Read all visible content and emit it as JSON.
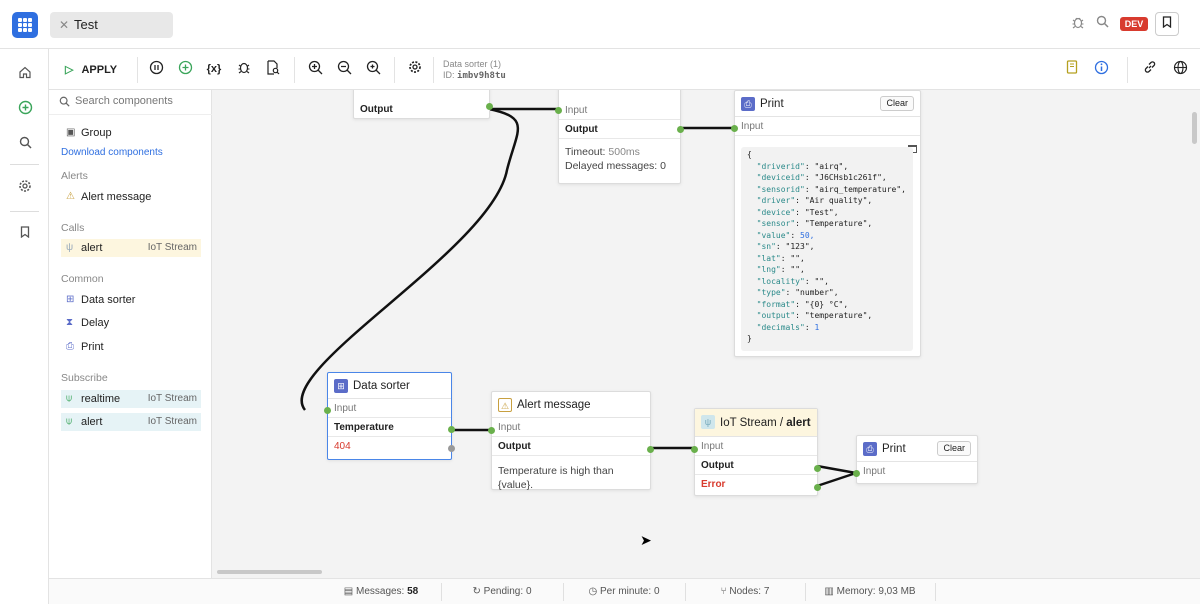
{
  "tab": {
    "title": "Test",
    "close": "✕"
  },
  "top_right": {
    "dev_badge": "DEV"
  },
  "toolbar": {
    "apply_label": "APPLY",
    "info_line1": "Data sorter (1)",
    "info_id_label": "ID:",
    "info_id_value": "imbv9h8tu"
  },
  "sidebar": {
    "search_placeholder": "Search components",
    "group_label": "Group",
    "download_link": "Download components",
    "sections": {
      "alerts": "Alerts",
      "calls": "Calls",
      "common": "Common",
      "subscribe": "Subscribe"
    },
    "items": {
      "alert_message": "Alert message",
      "call_alert": "alert",
      "call_alert_tag": "IoT Stream",
      "data_sorter": "Data sorter",
      "delay": "Delay",
      "print": "Print",
      "sub_realtime": "realtime",
      "sub_realtime_tag": "IoT Stream",
      "sub_alert": "alert",
      "sub_alert_tag": "IoT Stream"
    }
  },
  "nodes": {
    "top_left": {
      "output": "Output"
    },
    "delay": {
      "input": "Input",
      "output": "Output",
      "timeout_label": "Timeout:",
      "timeout_value": "500ms",
      "delayed_label": "Delayed messages:",
      "delayed_value": "0"
    },
    "print_top": {
      "title": "Print",
      "clear": "Clear",
      "input": "Input"
    },
    "data_sorter": {
      "title": "Data sorter",
      "input": "Input",
      "output": "Temperature",
      "value": "404"
    },
    "alert_message": {
      "title": "Alert message",
      "input": "Input",
      "output": "Output",
      "body": "Temperature is high than {value}."
    },
    "iot_stream": {
      "title_prefix": "IoT Stream / ",
      "title_bold": "alert",
      "input": "Input",
      "output": "Output",
      "error": "Error"
    },
    "print_bottom": {
      "title": "Print",
      "clear": "Clear",
      "input": "Input"
    }
  },
  "json_output": [
    {
      "t": "{"
    },
    {
      "k": "\"driverid\"",
      "v": "\"airq\","
    },
    {
      "k": "\"deviceid\"",
      "v": "\"J6CHsb1c261f\","
    },
    {
      "k": "\"sensorid\"",
      "v": "\"airq_temperature\","
    },
    {
      "k": "\"driver\"",
      "v": "\"Air quality\","
    },
    {
      "k": "\"device\"",
      "v": "\"Test\","
    },
    {
      "k": "\"sensor\"",
      "v": "\"Temperature\","
    },
    {
      "k": "\"value\"",
      "v": "50,",
      "num": true
    },
    {
      "k": "\"sn\"",
      "v": "\"123\","
    },
    {
      "k": "\"lat\"",
      "v": "\"\","
    },
    {
      "k": "\"lng\"",
      "v": "\"\","
    },
    {
      "k": "\"locality\"",
      "v": "\"\","
    },
    {
      "k": "\"type\"",
      "v": "\"number\","
    },
    {
      "k": "\"format\"",
      "v": "\"{0} °C\","
    },
    {
      "k": "\"output\"",
      "v": "\"temperature\","
    },
    {
      "k": "\"decimals\"",
      "v": "1",
      "num": true
    },
    {
      "t": "}"
    }
  ],
  "status": {
    "messages_label": "Messages:",
    "messages_value": "58",
    "pending_label": "Pending:",
    "pending_value": "0",
    "per_minute_label": "Per minute:",
    "per_minute_value": "0",
    "nodes_label": "Nodes:",
    "nodes_value": "7",
    "memory_label": "Memory:",
    "memory_value": "9,03 MB"
  },
  "colors": {
    "accent": "#2f6fe0",
    "port": "#6ab04c",
    "error": "#d83b2e",
    "dev_badge": "#d83b2e"
  }
}
